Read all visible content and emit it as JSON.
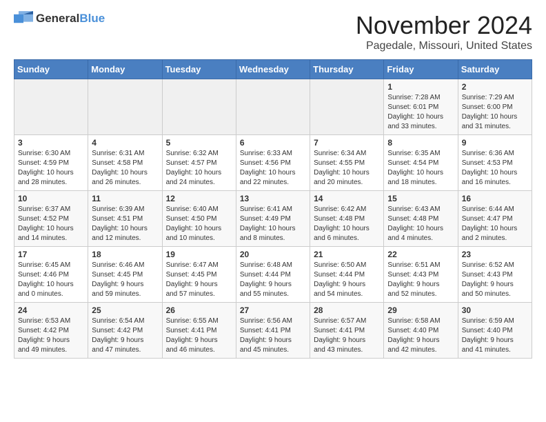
{
  "logo": {
    "text_general": "General",
    "text_blue": "Blue"
  },
  "header": {
    "month_title": "November 2024",
    "location": "Pagedale, Missouri, United States"
  },
  "weekdays": [
    "Sunday",
    "Monday",
    "Tuesday",
    "Wednesday",
    "Thursday",
    "Friday",
    "Saturday"
  ],
  "weeks": [
    [
      {
        "day": "",
        "info": ""
      },
      {
        "day": "",
        "info": ""
      },
      {
        "day": "",
        "info": ""
      },
      {
        "day": "",
        "info": ""
      },
      {
        "day": "",
        "info": ""
      },
      {
        "day": "1",
        "info": "Sunrise: 7:28 AM\nSunset: 6:01 PM\nDaylight: 10 hours\nand 33 minutes."
      },
      {
        "day": "2",
        "info": "Sunrise: 7:29 AM\nSunset: 6:00 PM\nDaylight: 10 hours\nand 31 minutes."
      }
    ],
    [
      {
        "day": "3",
        "info": "Sunrise: 6:30 AM\nSunset: 4:59 PM\nDaylight: 10 hours\nand 28 minutes."
      },
      {
        "day": "4",
        "info": "Sunrise: 6:31 AM\nSunset: 4:58 PM\nDaylight: 10 hours\nand 26 minutes."
      },
      {
        "day": "5",
        "info": "Sunrise: 6:32 AM\nSunset: 4:57 PM\nDaylight: 10 hours\nand 24 minutes."
      },
      {
        "day": "6",
        "info": "Sunrise: 6:33 AM\nSunset: 4:56 PM\nDaylight: 10 hours\nand 22 minutes."
      },
      {
        "day": "7",
        "info": "Sunrise: 6:34 AM\nSunset: 4:55 PM\nDaylight: 10 hours\nand 20 minutes."
      },
      {
        "day": "8",
        "info": "Sunrise: 6:35 AM\nSunset: 4:54 PM\nDaylight: 10 hours\nand 18 minutes."
      },
      {
        "day": "9",
        "info": "Sunrise: 6:36 AM\nSunset: 4:53 PM\nDaylight: 10 hours\nand 16 minutes."
      }
    ],
    [
      {
        "day": "10",
        "info": "Sunrise: 6:37 AM\nSunset: 4:52 PM\nDaylight: 10 hours\nand 14 minutes."
      },
      {
        "day": "11",
        "info": "Sunrise: 6:39 AM\nSunset: 4:51 PM\nDaylight: 10 hours\nand 12 minutes."
      },
      {
        "day": "12",
        "info": "Sunrise: 6:40 AM\nSunset: 4:50 PM\nDaylight: 10 hours\nand 10 minutes."
      },
      {
        "day": "13",
        "info": "Sunrise: 6:41 AM\nSunset: 4:49 PM\nDaylight: 10 hours\nand 8 minutes."
      },
      {
        "day": "14",
        "info": "Sunrise: 6:42 AM\nSunset: 4:48 PM\nDaylight: 10 hours\nand 6 minutes."
      },
      {
        "day": "15",
        "info": "Sunrise: 6:43 AM\nSunset: 4:48 PM\nDaylight: 10 hours\nand 4 minutes."
      },
      {
        "day": "16",
        "info": "Sunrise: 6:44 AM\nSunset: 4:47 PM\nDaylight: 10 hours\nand 2 minutes."
      }
    ],
    [
      {
        "day": "17",
        "info": "Sunrise: 6:45 AM\nSunset: 4:46 PM\nDaylight: 10 hours\nand 0 minutes."
      },
      {
        "day": "18",
        "info": "Sunrise: 6:46 AM\nSunset: 4:45 PM\nDaylight: 9 hours\nand 59 minutes."
      },
      {
        "day": "19",
        "info": "Sunrise: 6:47 AM\nSunset: 4:45 PM\nDaylight: 9 hours\nand 57 minutes."
      },
      {
        "day": "20",
        "info": "Sunrise: 6:48 AM\nSunset: 4:44 PM\nDaylight: 9 hours\nand 55 minutes."
      },
      {
        "day": "21",
        "info": "Sunrise: 6:50 AM\nSunset: 4:44 PM\nDaylight: 9 hours\nand 54 minutes."
      },
      {
        "day": "22",
        "info": "Sunrise: 6:51 AM\nSunset: 4:43 PM\nDaylight: 9 hours\nand 52 minutes."
      },
      {
        "day": "23",
        "info": "Sunrise: 6:52 AM\nSunset: 4:43 PM\nDaylight: 9 hours\nand 50 minutes."
      }
    ],
    [
      {
        "day": "24",
        "info": "Sunrise: 6:53 AM\nSunset: 4:42 PM\nDaylight: 9 hours\nand 49 minutes."
      },
      {
        "day": "25",
        "info": "Sunrise: 6:54 AM\nSunset: 4:42 PM\nDaylight: 9 hours\nand 47 minutes."
      },
      {
        "day": "26",
        "info": "Sunrise: 6:55 AM\nSunset: 4:41 PM\nDaylight: 9 hours\nand 46 minutes."
      },
      {
        "day": "27",
        "info": "Sunrise: 6:56 AM\nSunset: 4:41 PM\nDaylight: 9 hours\nand 45 minutes."
      },
      {
        "day": "28",
        "info": "Sunrise: 6:57 AM\nSunset: 4:41 PM\nDaylight: 9 hours\nand 43 minutes."
      },
      {
        "day": "29",
        "info": "Sunrise: 6:58 AM\nSunset: 4:40 PM\nDaylight: 9 hours\nand 42 minutes."
      },
      {
        "day": "30",
        "info": "Sunrise: 6:59 AM\nSunset: 4:40 PM\nDaylight: 9 hours\nand 41 minutes."
      }
    ]
  ]
}
